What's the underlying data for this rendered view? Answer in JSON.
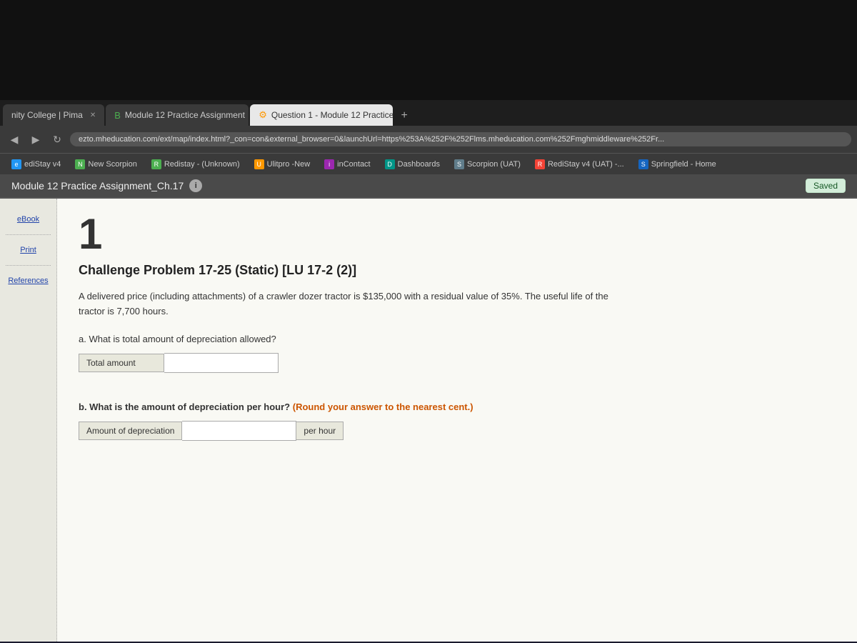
{
  "topbar": {
    "height": 140
  },
  "tabs": [
    {
      "id": "tab1",
      "label": "nity College | Pima",
      "active": false,
      "closeable": true
    },
    {
      "id": "tab2",
      "label": "Module 12 Practice Assignment",
      "active": false,
      "closeable": true
    },
    {
      "id": "tab3",
      "label": "Question 1 - Module 12 Practice",
      "active": true,
      "closeable": true
    }
  ],
  "tab_add_label": "+",
  "address_bar": {
    "url": "ezto.mheducation.com/ext/map/index.html?_con=con&external_browser=0&launchUrl=https%253A%252F%252Flms.mheducation.com%252Fmghmiddleware%252Fr..."
  },
  "nav_buttons": {
    "back": "◀",
    "forward": "▶",
    "refresh": "↻"
  },
  "bookmarks": [
    {
      "id": "bm1",
      "label": "ediStay v4",
      "icon_class": "bk-blue",
      "icon_text": "e"
    },
    {
      "id": "bm2",
      "label": "New Scorpion",
      "icon_class": "bk-green",
      "icon_text": "N"
    },
    {
      "id": "bm3",
      "label": "Redistay - (Unknown)",
      "icon_class": "bk-green",
      "icon_text": "R"
    },
    {
      "id": "bm4",
      "label": "Ulitpro -New",
      "icon_class": "bk-orange",
      "icon_text": "U"
    },
    {
      "id": "bm5",
      "label": "inContact",
      "icon_class": "bk-purple",
      "icon_text": "i"
    },
    {
      "id": "bm6",
      "label": "Dashboards",
      "icon_class": "bk-teal",
      "icon_text": "D"
    },
    {
      "id": "bm7",
      "label": "Scorpion (UAT)",
      "icon_class": "bk-gray",
      "icon_text": "S"
    },
    {
      "id": "bm8",
      "label": "RediStay v4 (UAT) -...",
      "icon_class": "bk-red",
      "icon_text": "R"
    },
    {
      "id": "bm9",
      "label": "Springfield - Home",
      "icon_class": "bk-darkblue",
      "icon_text": "S"
    }
  ],
  "page_header": {
    "title": "Module 12 Practice Assignment_Ch.17",
    "info": "i",
    "saved_badge": "Saved"
  },
  "sidebar": {
    "items": [
      {
        "id": "ebook",
        "label": "eBook"
      },
      {
        "id": "print",
        "label": "Print"
      },
      {
        "id": "references",
        "label": "References"
      }
    ]
  },
  "problem": {
    "number": "1",
    "title": "Challenge Problem 17-25 (Static) [LU 17-2 (2)]",
    "text": "A delivered price (including attachments) of a crawler dozer tractor is $135,000 with a residual value of 35%. The useful life of the tractor is 7,700 hours.",
    "question_a": {
      "label": "a. What is total amount of depreciation allowed?",
      "input_label": "Total amount",
      "input_value": "",
      "input_placeholder": ""
    },
    "question_b": {
      "label_start": "b. What is the amount of depreciation per hour?",
      "label_highlight": "(Round your answer to the nearest cent.)",
      "input_label": "Amount of depreciation",
      "input_value": "",
      "input_placeholder": "",
      "input_suffix": "per hour"
    }
  }
}
